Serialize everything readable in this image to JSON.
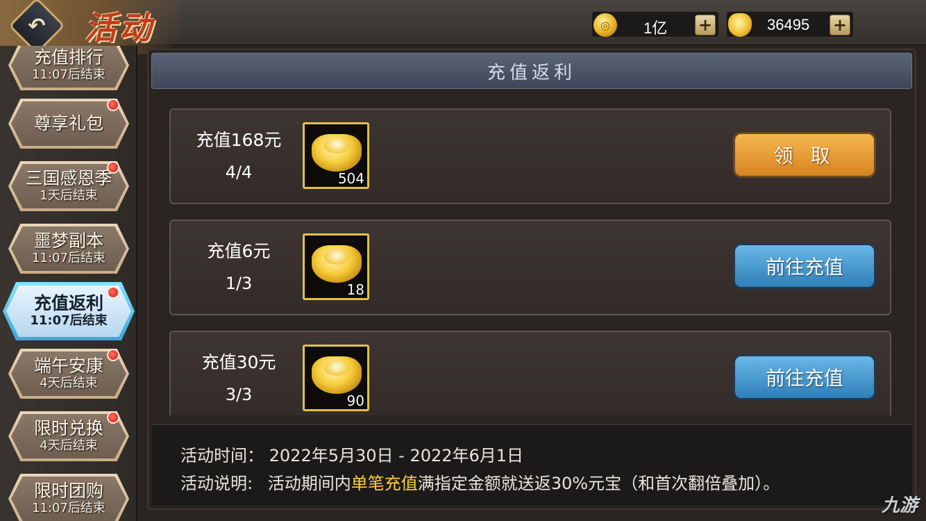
{
  "header": {
    "title": "活动",
    "back_icon": "back-arrow-icon"
  },
  "currencies": [
    {
      "icon": "gold-coin-icon",
      "value": "1亿"
    },
    {
      "icon": "gold-ingot-icon",
      "value": "36495"
    }
  ],
  "sidebar": {
    "items": [
      {
        "name": "充值排行",
        "sub": "11:07后结束",
        "dot": false,
        "active": false
      },
      {
        "name": "尊享礼包",
        "sub": "",
        "dot": true,
        "active": false
      },
      {
        "name": "三国感恩季",
        "sub": "1天后结束",
        "dot": true,
        "active": false
      },
      {
        "name": "噩梦副本",
        "sub": "11:07后结束",
        "dot": false,
        "active": false
      },
      {
        "name": "充值返利",
        "sub": "11:07后结束",
        "dot": true,
        "active": true
      },
      {
        "name": "端午安康",
        "sub": "4天后结束",
        "dot": true,
        "active": false
      },
      {
        "name": "限时兑换",
        "sub": "4天后结束",
        "dot": true,
        "active": false
      },
      {
        "name": "限时团购",
        "sub": "11:07后结束",
        "dot": false,
        "active": false
      }
    ]
  },
  "panel": {
    "title": "充值返利",
    "rewards": [
      {
        "requirement": "充值168元",
        "progress": "4/4",
        "item_icon": "gold-ingot-icon",
        "quantity": "504",
        "button": "领 取",
        "button_type": "claim"
      },
      {
        "requirement": "充值6元",
        "progress": "1/3",
        "item_icon": "gold-ingot-icon",
        "quantity": "18",
        "button": "前往充值",
        "button_type": "recharge"
      },
      {
        "requirement": "充值30元",
        "progress": "3/3",
        "item_icon": "gold-ingot-icon",
        "quantity": "90",
        "button": "前往充值",
        "button_type": "recharge"
      }
    ]
  },
  "info": {
    "time_label": "活动时间：",
    "time_value": "2022年5月30日 - 2022年6月1日",
    "desc_label": "活动说明:",
    "desc_prefix": "活动期间内",
    "desc_highlight": "单笔充值",
    "desc_suffix": "满指定金额就送返30%元宝（和首次翻倍叠加）。"
  },
  "watermark": "九游"
}
